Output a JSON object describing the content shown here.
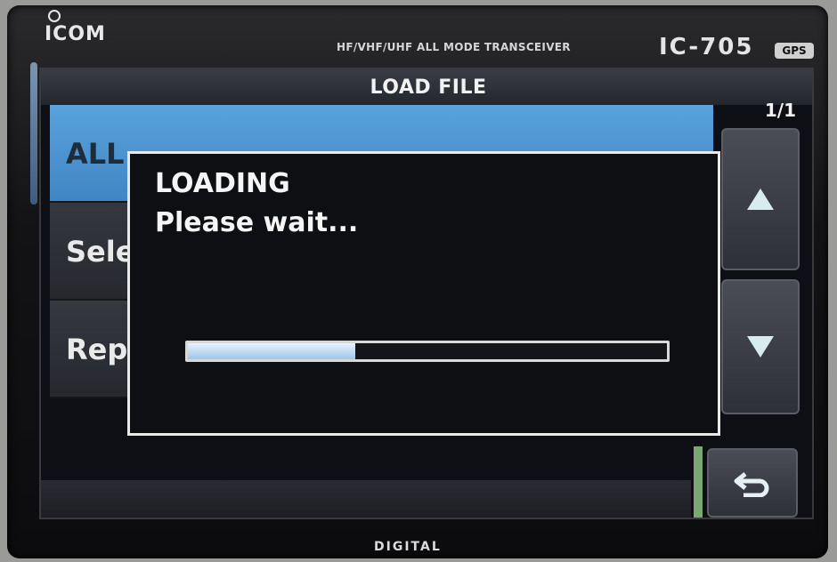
{
  "device": {
    "brand": "ICOM",
    "model_description": "HF/VHF/UHF ALL MODE TRANSCEIVER",
    "model_name": "IC-705",
    "gps_badge": "GPS",
    "bottom_label": "DIGITAL"
  },
  "screen": {
    "title": "LOAD FILE",
    "page_indicator": "1/1",
    "list_items": [
      {
        "label": "ALL",
        "selected": true
      },
      {
        "label": "Sele",
        "selected": false
      },
      {
        "label": "Rep",
        "selected": false
      }
    ],
    "buttons": {
      "scroll_up_icon": "triangle-up-icon",
      "scroll_down_icon": "triangle-down-icon",
      "back_icon": "return-arrow-icon"
    }
  },
  "dialog": {
    "title": "LOADING",
    "message": "Please wait...",
    "progress": 0.35
  },
  "colors": {
    "selected_item": "#4a93d2",
    "accent_green": "#7aa774",
    "dialog_border": "#e9e9e9"
  }
}
